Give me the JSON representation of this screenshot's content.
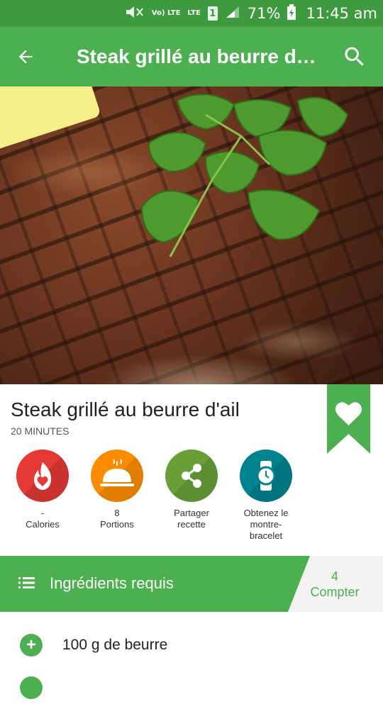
{
  "status_bar": {
    "network_label": "LTE",
    "volte_label": "Vo) LTE",
    "sim_label": "1",
    "battery": "71%",
    "time": "11:45 am"
  },
  "toolbar": {
    "title": "Steak grillé au beurre d'ail",
    "back_icon": "arrow-left-icon",
    "search_icon": "search-icon",
    "color": "#4caf50"
  },
  "recipe": {
    "title": "Steak grillé au beurre d'ail",
    "duration": "20 MINUTES"
  },
  "actions": [
    {
      "icon": "calories-icon",
      "line1": "-",
      "line2": "Calories",
      "color": "#e53935"
    },
    {
      "icon": "portions-icon",
      "line1": "8",
      "line2": "Portions",
      "color": "#fb8c00"
    },
    {
      "icon": "share-icon",
      "line1": "Partager",
      "line2": "recette",
      "color": "#689f38"
    },
    {
      "icon": "watch-icon",
      "line1": "Obtenez le",
      "line2": "montre-",
      "line3": "bracelet",
      "color": "#00838f"
    }
  ],
  "ingredients": {
    "header": "Ingrédients requis",
    "count_value": "4",
    "count_label": "Compter",
    "items": [
      "100 g de beurre"
    ]
  }
}
